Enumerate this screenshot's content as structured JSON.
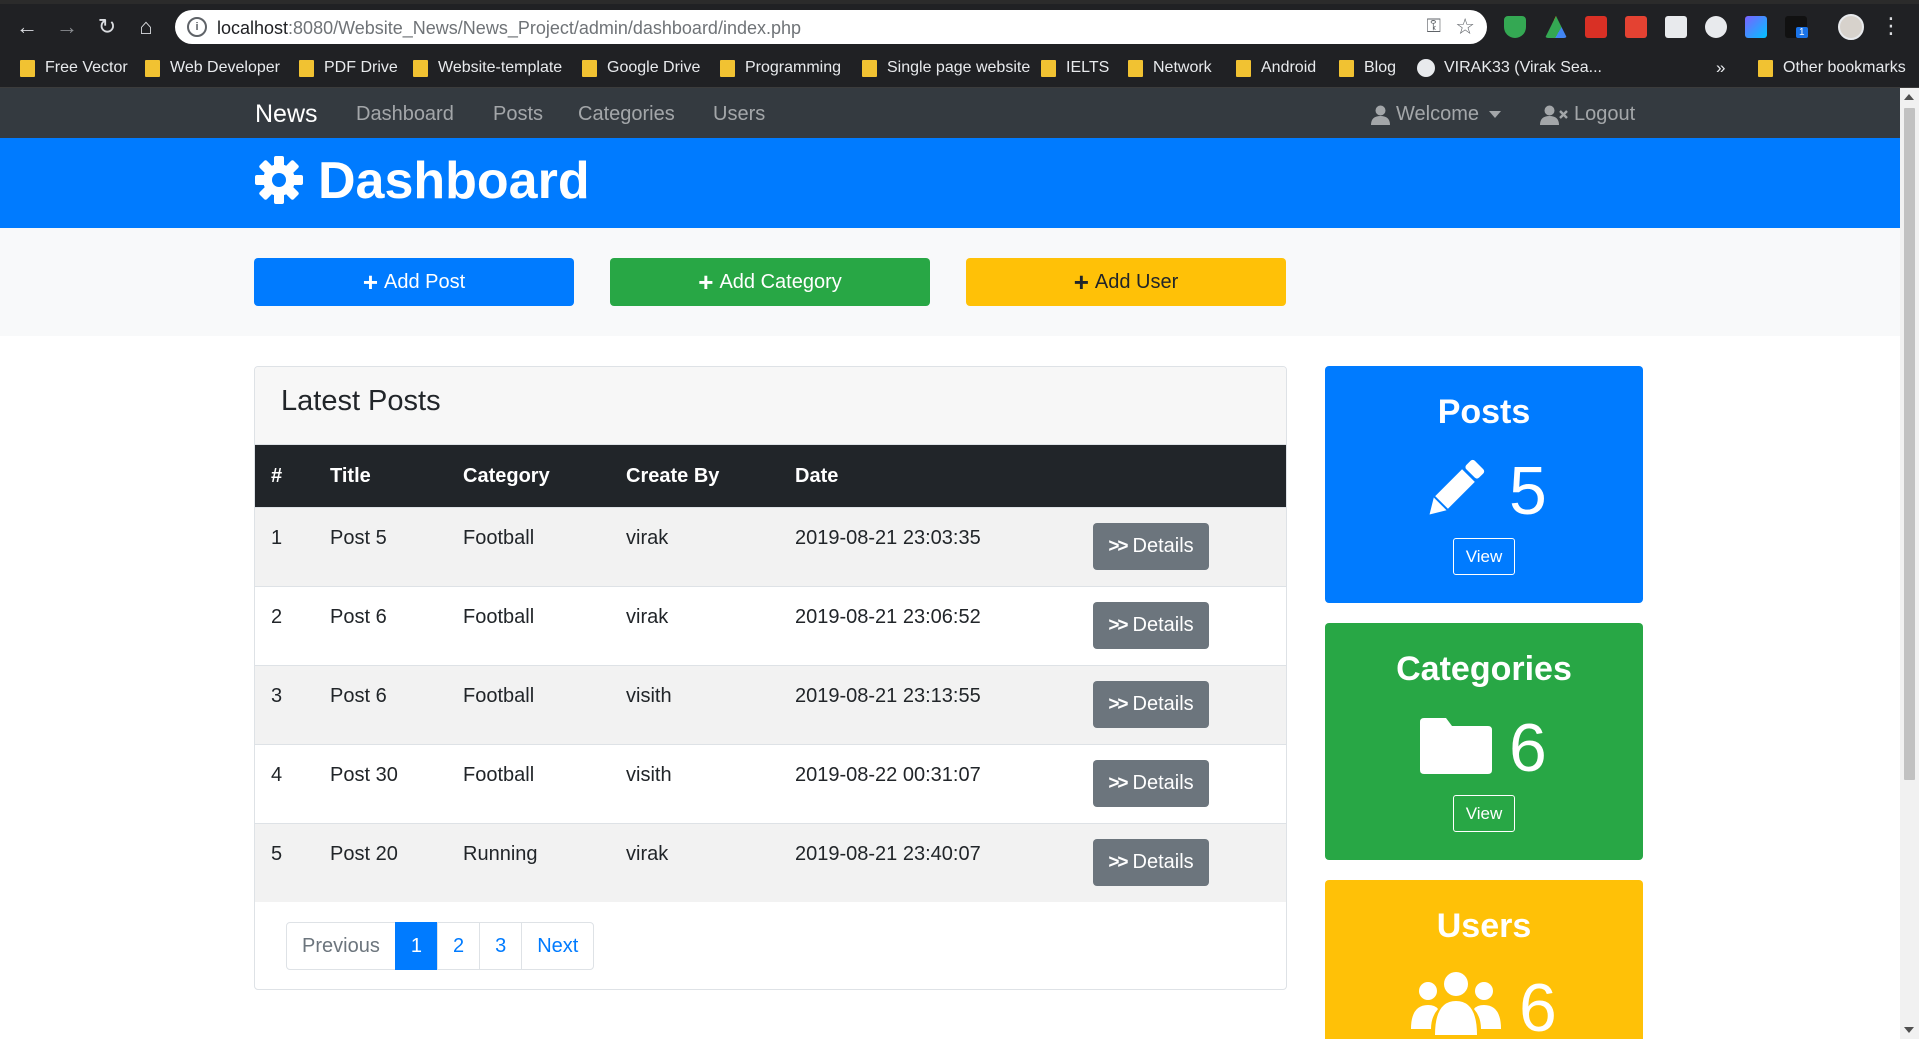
{
  "browser": {
    "url_host": "localhost",
    "url_path": ":8080/Website_News/News_Project/admin/dashboard/index.php",
    "bookmarks": [
      "Free Vector",
      "Web Developer",
      "PDF Drive",
      "Website-template",
      "Google Drive",
      "Programming",
      "Single page website",
      "IELTS",
      "Network",
      "Android",
      "Blog",
      "VIRAK33 (Virak Sea..."
    ],
    "overflow": "»",
    "other_bookmarks": "Other bookmarks",
    "extension_badge": "1"
  },
  "navbar": {
    "brand": "News",
    "links": [
      "Dashboard",
      "Posts",
      "Categories",
      "Users"
    ],
    "welcome": "Welcome",
    "logout": "Logout"
  },
  "header": {
    "title": "Dashboard"
  },
  "actions": {
    "add_post": "Add Post",
    "add_category": "Add Category",
    "add_user": "Add User"
  },
  "latest_posts": {
    "title": "Latest Posts",
    "columns": [
      "#",
      "Title",
      "Category",
      "Create By",
      "Date"
    ],
    "rows": [
      {
        "num": "1",
        "title": "Post 5",
        "category": "Football",
        "author": "virak",
        "date": "2019-08-21 23:03:35"
      },
      {
        "num": "2",
        "title": "Post 6",
        "category": "Football",
        "author": "virak",
        "date": "2019-08-21 23:06:52"
      },
      {
        "num": "3",
        "title": "Post 6",
        "category": "Football",
        "author": "visith",
        "date": "2019-08-21 23:13:55"
      },
      {
        "num": "4",
        "title": "Post 30",
        "category": "Football",
        "author": "visith",
        "date": "2019-08-22 00:31:07"
      },
      {
        "num": "5",
        "title": "Post 20",
        "category": "Running",
        "author": "virak",
        "date": "2019-08-21 23:40:07"
      }
    ],
    "details_label": "Details",
    "pagination": {
      "previous": "Previous",
      "pages": [
        "1",
        "2",
        "3"
      ],
      "active": "1",
      "next": "Next"
    }
  },
  "stats": {
    "posts": {
      "title": "Posts",
      "count": "5",
      "view": "View",
      "color": "#007bff"
    },
    "categories": {
      "title": "Categories",
      "count": "6",
      "view": "View",
      "color": "#28a745"
    },
    "users": {
      "title": "Users",
      "count": "6",
      "color": "#ffc107"
    }
  },
  "colors": {
    "primary": "#007bff",
    "success": "#28a745",
    "warning": "#ffc107",
    "dark": "#343a40",
    "secondary": "#6c757d"
  }
}
